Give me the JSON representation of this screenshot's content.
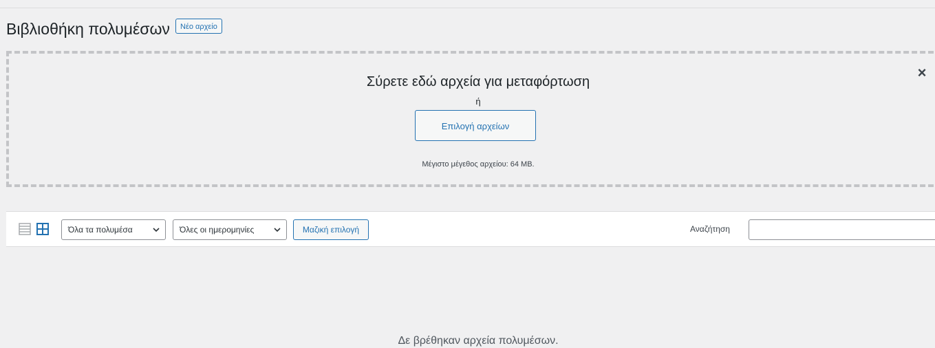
{
  "header": {
    "title": "Βιβλιοθήκη πολυμέσων",
    "add_new_label": "Νέο αρχείο"
  },
  "uploader": {
    "drop_instructions": "Σύρετε εδώ αρχεία για μεταφόρτωση",
    "or_text": "ή",
    "select_files_label": "Επιλογή αρχείων",
    "max_upload_size": "Μέγιστο μέγεθος αρχείου: 64 MB.",
    "close_symbol": "×"
  },
  "toolbar": {
    "view_modes": [
      {
        "name": "list-view-icon",
        "active": false
      },
      {
        "name": "grid-view-icon",
        "active": true
      }
    ],
    "media_type_filter": "Όλα τα πολυμέσα",
    "date_filter": "Όλες οι ημερομηνίες",
    "bulk_select_label": "Μαζική επιλογή",
    "search_label": "Αναζήτηση",
    "search_value": ""
  },
  "content": {
    "empty_message": "Δε βρέθηκαν αρχεία πολυμέσων."
  },
  "colors": {
    "accent": "#2271b1",
    "background": "#f0f0f1",
    "text": "#1d2327",
    "border": "#c3c4c7"
  }
}
